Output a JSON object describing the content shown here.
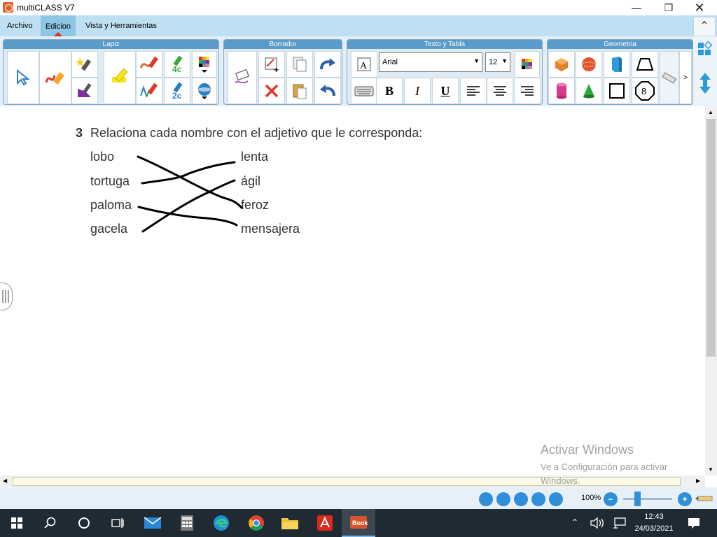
{
  "window": {
    "title": "multiCLASS V7"
  },
  "menu": {
    "archivo": "Archivo",
    "edicion": "Edicion",
    "vista": "Vista y Herramientas"
  },
  "ribbon": {
    "groups": {
      "lapiz": "Lapiz",
      "borrador": "Borrador",
      "texto": "Texto y Tabla",
      "geometria": "Geometria"
    },
    "font_name": "Arial",
    "font_size": "12",
    "bold": "B",
    "italic": "I",
    "underline": "U",
    "lapiz_4c": "4c",
    "lapiz_2c": "2c",
    "octagon_num": "8"
  },
  "exercise": {
    "number": "3",
    "instruction": "Relaciona cada nombre con el adjetivo que le corresponda:",
    "left": [
      "lobo",
      "tortuga",
      "paloma",
      "gacela"
    ],
    "right": [
      "lenta",
      "ágil",
      "feroz",
      "mensajera"
    ]
  },
  "watermark": {
    "title": "Activar Windows",
    "subtitle": "Ve a Configuración para activar Windows."
  },
  "status": {
    "zoom": "100%"
  },
  "taskbar": {
    "time": "12:43",
    "date": "24/03/2021",
    "book_label": "Book"
  }
}
